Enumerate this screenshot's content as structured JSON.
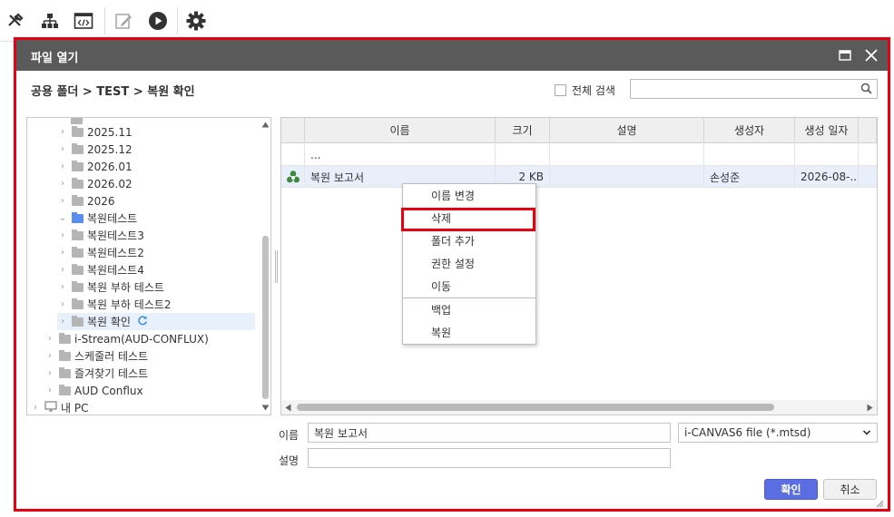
{
  "dialog": {
    "title": "파일 열기",
    "breadcrumb": "공용 폴더 > TEST > 복원 확인",
    "full_search_label": "전체 검색",
    "search_placeholder": ""
  },
  "tree": {
    "items": [
      {
        "label": "2025.11"
      },
      {
        "label": "2025.12"
      },
      {
        "label": "2026.01"
      },
      {
        "label": "2026.02"
      },
      {
        "label": "2026"
      },
      {
        "label": "복원테스트"
      },
      {
        "label": "복원테스트3"
      },
      {
        "label": "복원테스트2"
      },
      {
        "label": "복원테스트4"
      },
      {
        "label": "복원 부하 테스트"
      },
      {
        "label": "복원 부하 테스트2"
      },
      {
        "label": "복원 확인"
      },
      {
        "label": "i-Stream(AUD-CONFLUX)"
      },
      {
        "label": "스케줄러 테스트"
      },
      {
        "label": "즐겨찾기 테스트"
      },
      {
        "label": "AUD Conflux"
      },
      {
        "label": "내 PC"
      }
    ]
  },
  "grid": {
    "columns": [
      "이름",
      "크기",
      "설명",
      "생성자",
      "생성 일자"
    ],
    "rows": [
      {
        "name": "...",
        "size": "",
        "desc": "",
        "creator": "",
        "date": ""
      },
      {
        "name": "복원 보고서",
        "size": "2 KB",
        "desc": "",
        "creator": "손성준",
        "date": "2026-08-..."
      }
    ]
  },
  "context_menu": {
    "items": [
      "이름 변경",
      "삭제",
      "폴더 추가",
      "권한 설정",
      "이동",
      "백업",
      "복원"
    ]
  },
  "form": {
    "name_label": "이름",
    "name_value": "복원 보고서",
    "desc_label": "설명",
    "desc_value": "",
    "file_type": "i-CANVAS6 file (*.mtsd)",
    "ok_label": "확인",
    "cancel_label": "취소"
  },
  "colors": {
    "highlight": "#e60012",
    "titlebar": "#5a5a5a",
    "primary_button": "#5b6ee1",
    "folder": "#b5b5b5",
    "folder_open": "#5b8def"
  }
}
